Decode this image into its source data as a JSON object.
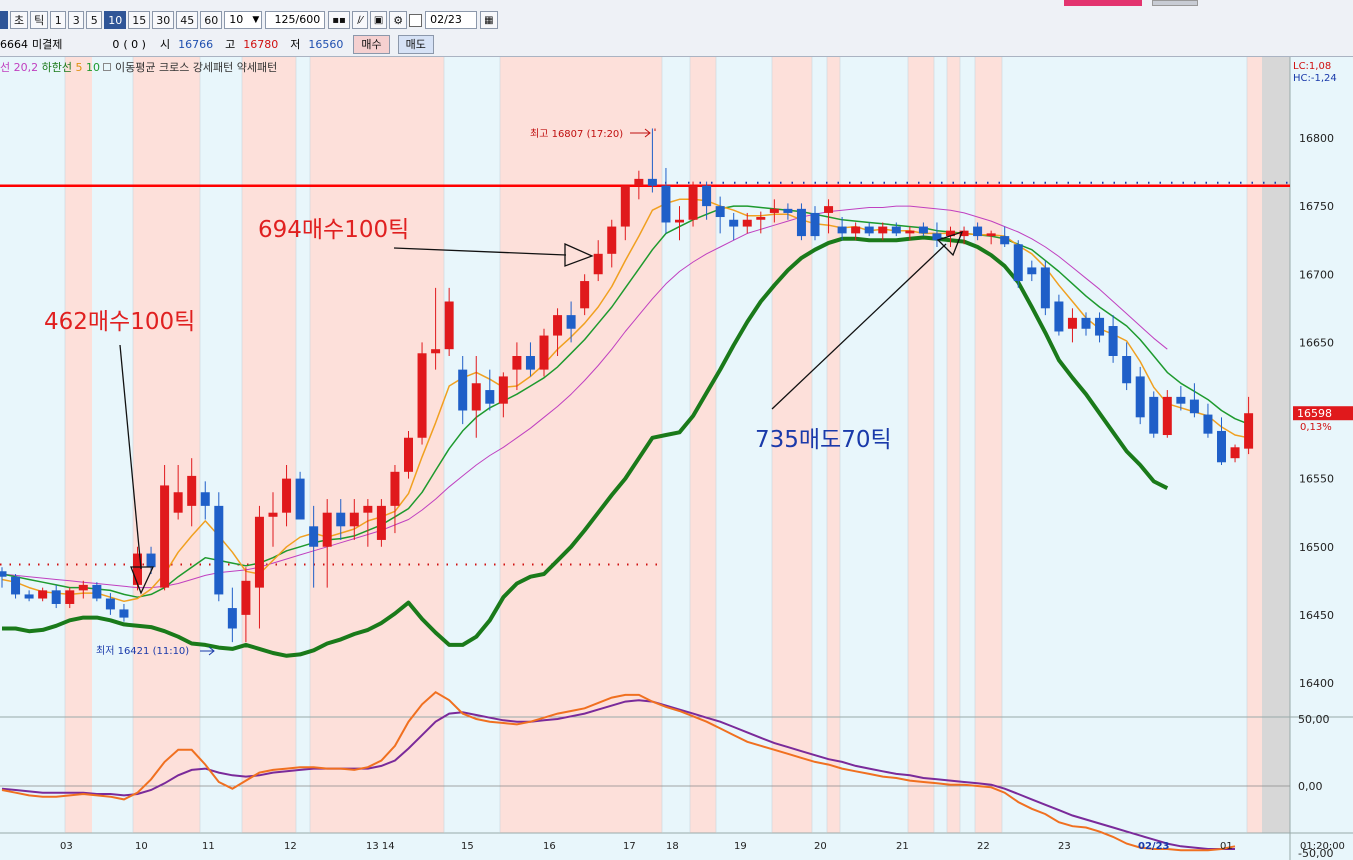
{
  "toolbar": {
    "buttons": [
      "초",
      "틱",
      "1",
      "3",
      "5",
      "10",
      "15",
      "30",
      "45",
      "60"
    ],
    "active_button": "10",
    "interval_value": "10",
    "count_value": "125/600",
    "date_value": "02/23"
  },
  "info_row": {
    "left_value": "6664",
    "unsettled_label": "미결제",
    "unsettled_value": "0",
    "unsettled_change": "( 0 )",
    "open_label": "시",
    "open_value": "16766",
    "high_label": "고",
    "high_value": "16780",
    "low_label": "저",
    "low_value": "16560",
    "buy_label": "매수",
    "sell_label": "매도"
  },
  "legend": {
    "text_a": "선 20,2",
    "text_b": "하한선",
    "text_c": "5",
    "text_d": "10",
    "text_e": "이동평균 크로스 강세패턴  약세패턴"
  },
  "colors": {
    "bg": "#e8f6fb",
    "shade": "#fde0da",
    "up": "#e0191c",
    "down": "#1f5fc8",
    "ma5": "#f0a020",
    "ma10": "#1e9a2e",
    "ma_long": "#c040c0",
    "lower_band": "#1a7a1a",
    "resistance": "#ff0000",
    "osc_orange": "#f07020",
    "osc_purple": "#7a2a9a"
  },
  "chart_data": [
    {
      "type": "candlestick",
      "ylim": [
        16370,
        16840
      ],
      "y_ticks": [
        16400,
        16450,
        16500,
        16550,
        16600,
        16650,
        16700,
        16750,
        16800
      ],
      "x_ticks": [
        "03",
        "10",
        "11",
        "12",
        "13 14",
        "15",
        "16",
        "17",
        "18",
        "19",
        "20",
        "21",
        "22",
        "23",
        "02/23",
        "01",
        "01:20:00"
      ],
      "top_right_labels": [
        "LC:1,08",
        "HC:-1,24"
      ],
      "last_price": "16598",
      "last_change": "0,13%",
      "resistance": 16765,
      "high_annotation": "최고 16807 (17:20)",
      "low_annotation": "최저 16421 (11:10)",
      "annotations": [
        "462매수100틱",
        "694매수100틱",
        "735매도70틱"
      ],
      "candles": [
        [
          16482,
          16485,
          16470,
          16478
        ],
        [
          16478,
          16480,
          16462,
          16465
        ],
        [
          16465,
          16468,
          16460,
          16462
        ],
        [
          16462,
          16470,
          16460,
          16468
        ],
        [
          16468,
          16472,
          16455,
          16458
        ],
        [
          16458,
          16470,
          16455,
          16468
        ],
        [
          16468,
          16475,
          16462,
          16472
        ],
        [
          16472,
          16474,
          16460,
          16462
        ],
        [
          16462,
          16466,
          16450,
          16454
        ],
        [
          16454,
          16458,
          16445,
          16448
        ],
        [
          16472,
          16500,
          16468,
          16495
        ],
        [
          16495,
          16500,
          16480,
          16485
        ],
        [
          16470,
          16560,
          16468,
          16545
        ],
        [
          16525,
          16560,
          16520,
          16540
        ],
        [
          16530,
          16565,
          16515,
          16552
        ],
        [
          16540,
          16548,
          16520,
          16530
        ],
        [
          16530,
          16540,
          16460,
          16465
        ],
        [
          16455,
          16470,
          16430,
          16440
        ],
        [
          16450,
          16485,
          16430,
          16475
        ],
        [
          16470,
          16530,
          16440,
          16522
        ],
        [
          16522,
          16540,
          16500,
          16525
        ],
        [
          16525,
          16560,
          16515,
          16550
        ],
        [
          16550,
          16555,
          16520,
          16520
        ],
        [
          16515,
          16530,
          16470,
          16500
        ],
        [
          16500,
          16535,
          16470,
          16525
        ],
        [
          16525,
          16535,
          16505,
          16515
        ],
        [
          16515,
          16535,
          16505,
          16525
        ],
        [
          16525,
          16535,
          16500,
          16530
        ],
        [
          16505,
          16535,
          16500,
          16530
        ],
        [
          16530,
          16560,
          16510,
          16555
        ],
        [
          16555,
          16585,
          16550,
          16580
        ],
        [
          16580,
          16650,
          16575,
          16642
        ],
        [
          16642,
          16690,
          16630,
          16645
        ],
        [
          16645,
          16690,
          16640,
          16680
        ],
        [
          16630,
          16640,
          16590,
          16600
        ],
        [
          16600,
          16640,
          16580,
          16620
        ],
        [
          16615,
          16630,
          16600,
          16605
        ],
        [
          16605,
          16628,
          16595,
          16625
        ],
        [
          16630,
          16650,
          16615,
          16640
        ],
        [
          16640,
          16650,
          16625,
          16630
        ],
        [
          16630,
          16660,
          16625,
          16655
        ],
        [
          16655,
          16675,
          16640,
          16670
        ],
        [
          16670,
          16680,
          16650,
          16660
        ],
        [
          16675,
          16700,
          16670,
          16695
        ],
        [
          16700,
          16725,
          16695,
          16715
        ],
        [
          16715,
          16740,
          16705,
          16735
        ],
        [
          16735,
          16765,
          16725,
          16765
        ],
        [
          16765,
          16776,
          16755,
          16770
        ],
        [
          16770,
          16807,
          16760,
          16765
        ],
        [
          16765,
          16778,
          16730,
          16738
        ],
        [
          16738,
          16750,
          16725,
          16740
        ],
        [
          16740,
          16768,
          16735,
          16765
        ],
        [
          16765,
          16768,
          16740,
          16750
        ],
        [
          16750,
          16757,
          16730,
          16742
        ],
        [
          16740,
          16745,
          16725,
          16735
        ],
        [
          16735,
          16745,
          16730,
          16740
        ],
        [
          16740,
          16746,
          16730,
          16742
        ],
        [
          16745,
          16755,
          16738,
          16748
        ],
        [
          16748,
          16752,
          16740,
          16745
        ],
        [
          16748,
          16752,
          16725,
          16728
        ],
        [
          16745,
          16750,
          16725,
          16728
        ],
        [
          16745,
          16755,
          16730,
          16750
        ],
        [
          16735,
          16742,
          16725,
          16730
        ],
        [
          16730,
          16738,
          16725,
          16735
        ],
        [
          16735,
          16738,
          16728,
          16730
        ],
        [
          16730,
          16738,
          16725,
          16735
        ],
        [
          16735,
          16738,
          16728,
          16730
        ],
        [
          16730,
          16735,
          16725,
          16732
        ],
        [
          16735,
          16738,
          16728,
          16730
        ],
        [
          16730,
          16738,
          16720,
          16725
        ],
        [
          16728,
          16735,
          16720,
          16732
        ],
        [
          16728,
          16735,
          16722,
          16732
        ],
        [
          16735,
          16738,
          16725,
          16728
        ],
        [
          16728,
          16732,
          16722,
          16730
        ],
        [
          16728,
          16735,
          16720,
          16722
        ],
        [
          16722,
          16725,
          16690,
          16695
        ],
        [
          16705,
          16710,
          16695,
          16700
        ],
        [
          16705,
          16710,
          16670,
          16675
        ],
        [
          16680,
          16685,
          16655,
          16658
        ],
        [
          16660,
          16675,
          16650,
          16668
        ],
        [
          16668,
          16672,
          16655,
          16660
        ],
        [
          16668,
          16672,
          16650,
          16655
        ],
        [
          16662,
          16670,
          16635,
          16640
        ],
        [
          16640,
          16650,
          16615,
          16620
        ],
        [
          16625,
          16632,
          16590,
          16595
        ],
        [
          16610,
          16614,
          16580,
          16583
        ],
        [
          16582,
          16615,
          16580,
          16610
        ],
        [
          16610,
          16618,
          16600,
          16605
        ],
        [
          16608,
          16620,
          16595,
          16598
        ],
        [
          16597,
          16605,
          16580,
          16583
        ],
        [
          16585,
          16595,
          16560,
          16562
        ],
        [
          16565,
          16575,
          16562,
          16573
        ],
        [
          16572,
          16610,
          16568,
          16598
        ]
      ],
      "ma5": [
        16476,
        16474,
        16470,
        16467,
        16466,
        16465,
        16466,
        16466,
        16463,
        16460,
        16462,
        16469,
        16480,
        16496,
        16508,
        16519,
        16508,
        16496,
        16482,
        16480,
        16490,
        16500,
        16507,
        16510,
        16507,
        16510,
        16513,
        16519,
        16522,
        16526,
        16539,
        16566,
        16591,
        16618,
        16624,
        16628,
        16623,
        16617,
        16618,
        16625,
        16634,
        16645,
        16654,
        16664,
        16676,
        16691,
        16710,
        16728,
        16747,
        16752,
        16755,
        16755,
        16754,
        16750,
        16747,
        16743,
        16743,
        16744,
        16744,
        16740,
        16737,
        16736,
        16734,
        16735,
        16732,
        16733,
        16732,
        16732,
        16730,
        16730,
        16730,
        16730,
        16729,
        16729,
        16728,
        16721,
        16715,
        16705,
        16692,
        16680,
        16668,
        16660,
        16656,
        16651,
        16636,
        16617,
        16605,
        16602,
        16599,
        16596,
        16588,
        16582,
        16580
      ],
      "ma10": [
        16480,
        16478,
        16476,
        16474,
        16472,
        16470,
        16470,
        16469,
        16468,
        16465,
        16463,
        16465,
        16470,
        16478,
        16485,
        16492,
        16490,
        16488,
        16486,
        16488,
        16492,
        16497,
        16500,
        16503,
        16505,
        16506,
        16508,
        16512,
        16516,
        16522,
        16528,
        16540,
        16556,
        16572,
        16585,
        16595,
        16602,
        16607,
        16612,
        16618,
        16624,
        16632,
        16642,
        16652,
        16664,
        16676,
        16690,
        16704,
        16718,
        16730,
        16735,
        16740,
        16744,
        16748,
        16750,
        16750,
        16749,
        16748,
        16747,
        16746,
        16744,
        16742,
        16740,
        16739,
        16738,
        16737,
        16736,
        16735,
        16734,
        16732,
        16731,
        16730,
        16729,
        16728,
        16726,
        16722,
        16718,
        16710,
        16702,
        16693,
        16684,
        16676,
        16669,
        16662,
        16652,
        16640,
        16628,
        16620,
        16614,
        16608,
        16600,
        16594,
        16590
      ],
      "ma_long": [
        16480,
        16479,
        16478,
        16477,
        16476,
        16475,
        16474,
        16473,
        16472,
        16471,
        16470,
        16470,
        16471,
        16473,
        16476,
        16479,
        16481,
        16482,
        16483,
        16485,
        16488,
        16491,
        16494,
        16497,
        16500,
        16503,
        16506,
        16509,
        16512,
        16516,
        16520,
        16527,
        16535,
        16544,
        16552,
        16560,
        16567,
        16573,
        16580,
        16587,
        16595,
        16603,
        16612,
        16622,
        16633,
        16645,
        16658,
        16670,
        16682,
        16693,
        16702,
        16709,
        16715,
        16720,
        16725,
        16730,
        16733,
        16736,
        16739,
        16742,
        16744,
        16746,
        16747,
        16748,
        16749,
        16749,
        16750,
        16750,
        16749,
        16748,
        16747,
        16745,
        16742,
        16739,
        16735,
        16731,
        16726,
        16720,
        16713,
        16705,
        16697,
        16689,
        16680,
        16671,
        16662,
        16653,
        16645
      ],
      "lower_band": [
        16440,
        16440,
        16438,
        16439,
        16442,
        16446,
        16448,
        16448,
        16446,
        16443,
        16442,
        16441,
        16438,
        16434,
        16429,
        16428,
        16426,
        16425,
        16428,
        16425,
        16422,
        16420,
        16421,
        16424,
        16429,
        16432,
        16436,
        16439,
        16444,
        16451,
        16459,
        16447,
        16437,
        16428,
        16428,
        16434,
        16446,
        16463,
        16473,
        16478,
        16480,
        16490,
        16500,
        16512,
        16525,
        16538,
        16550,
        16565,
        16580,
        16582,
        16584,
        16596,
        16613,
        16630,
        16648,
        16665,
        16680,
        16692,
        16703,
        16712,
        16718,
        16723,
        16726,
        16726,
        16725,
        16725,
        16725,
        16726,
        16727,
        16726,
        16725,
        16724,
        16720,
        16714,
        16706,
        16694,
        16676,
        16657,
        16637,
        16624,
        16612,
        16598,
        16584,
        16570,
        16560,
        16548,
        16543
      ],
      "oscillator_ylim": [
        -60,
        75
      ],
      "oscillator_ticks": [
        "50,00",
        "0,00",
        "-50,00"
      ],
      "osc_orange": [
        -3,
        -5,
        -7,
        -8,
        -8,
        -7,
        -6,
        -7,
        -8,
        -10,
        -5,
        5,
        18,
        27,
        27,
        16,
        3,
        -2,
        4,
        10,
        12,
        13,
        14,
        14,
        13,
        13,
        12,
        14,
        19,
        30,
        48,
        61,
        70,
        64,
        54,
        50,
        48,
        47,
        46,
        48,
        51,
        54,
        56,
        58,
        62,
        66,
        68,
        68,
        63,
        59,
        56,
        52,
        48,
        43,
        38,
        33,
        30,
        27,
        24,
        21,
        18,
        16,
        13,
        11,
        9,
        7,
        6,
        4,
        3,
        2,
        1,
        1,
        0,
        -1,
        -5,
        -12,
        -17,
        -21,
        -27,
        -30,
        -31,
        -34,
        -38,
        -43,
        -46,
        -47,
        -47,
        -48,
        -48,
        -48,
        -47,
        -45
      ],
      "osc_purple": [
        -2,
        -3,
        -4,
        -5,
        -5,
        -5,
        -5,
        -6,
        -6,
        -7,
        -6,
        -3,
        2,
        8,
        12,
        13,
        10,
        8,
        7,
        8,
        10,
        11,
        12,
        13,
        13,
        13,
        13,
        13,
        15,
        19,
        28,
        38,
        48,
        54,
        55,
        53,
        51,
        49,
        48,
        48,
        49,
        50,
        52,
        54,
        57,
        60,
        63,
        64,
        63,
        60,
        57,
        54,
        51,
        48,
        44,
        40,
        36,
        32,
        29,
        26,
        23,
        20,
        18,
        15,
        13,
        11,
        9,
        8,
        6,
        5,
        4,
        3,
        2,
        1,
        -2,
        -6,
        -10,
        -14,
        -18,
        -22,
        -25,
        -28,
        -31,
        -34,
        -37,
        -40,
        -43,
        -45,
        -46,
        -47,
        -47,
        -47
      ]
    }
  ]
}
